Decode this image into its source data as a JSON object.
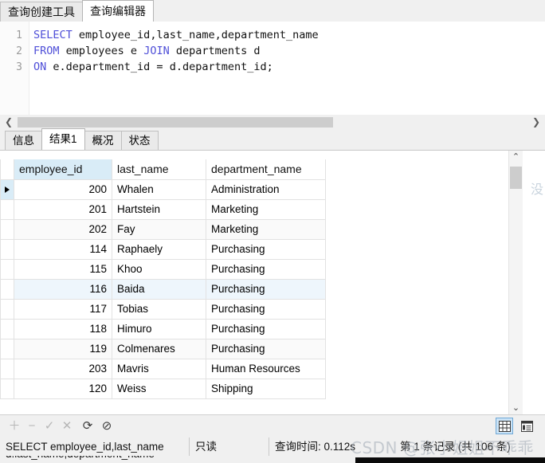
{
  "window": {
    "tabs": [
      {
        "label": "查询创建工具",
        "active": false
      },
      {
        "label": "查询编辑器",
        "active": true
      }
    ]
  },
  "editor": {
    "lines": [
      {
        "no": "1",
        "keyword": "SELECT",
        "rest": " employee_id,last_name,department_name"
      },
      {
        "no": "2",
        "keyword": "FROM",
        "rest": " employees e ",
        "keyword2": "JOIN",
        "rest2": " departments d"
      },
      {
        "no": "3",
        "keyword": "ON",
        "rest": " e.department_id = d.department_id;"
      }
    ]
  },
  "scroll": {
    "left_arrow": "❮",
    "right_arrow": "❯",
    "up_arrow": "⌃",
    "down_arrow": "⌄"
  },
  "result_tabs": [
    {
      "label": "信息",
      "active": false
    },
    {
      "label": "结果1",
      "active": true
    },
    {
      "label": "概况",
      "active": false
    },
    {
      "label": "状态",
      "active": false
    }
  ],
  "grid": {
    "columns": [
      "employee_id",
      "last_name",
      "department_name"
    ],
    "rows": [
      {
        "employee_id": "200",
        "last_name": "Whalen",
        "department_name": "Administration"
      },
      {
        "employee_id": "201",
        "last_name": "Hartstein",
        "department_name": "Marketing"
      },
      {
        "employee_id": "202",
        "last_name": "Fay",
        "department_name": "Marketing"
      },
      {
        "employee_id": "114",
        "last_name": "Raphaely",
        "department_name": "Purchasing"
      },
      {
        "employee_id": "115",
        "last_name": "Khoo",
        "department_name": "Purchasing"
      },
      {
        "employee_id": "116",
        "last_name": "Baida",
        "department_name": "Purchasing"
      },
      {
        "employee_id": "117",
        "last_name": "Tobias",
        "department_name": "Purchasing"
      },
      {
        "employee_id": "118",
        "last_name": "Himuro",
        "department_name": "Purchasing"
      },
      {
        "employee_id": "119",
        "last_name": "Colmenares",
        "department_name": "Purchasing"
      },
      {
        "employee_id": "203",
        "last_name": "Mavris",
        "department_name": "Human Resources"
      },
      {
        "employee_id": "120",
        "last_name": "Weiss",
        "department_name": "Shipping"
      }
    ],
    "current_row_index": 0,
    "selected_row_index": 5
  },
  "toolbar": {
    "add": "＋",
    "remove": "−",
    "confirm": "✓",
    "cancel": "✕",
    "refresh": "⟳",
    "stop": "⊘",
    "grid_view_icon": "grid-view",
    "form_view_icon": "form-view"
  },
  "status": {
    "sql_fragment": "SELECT employee_id,last_name",
    "readonly": "只读",
    "query_time": "查询时间: 0.112s",
    "record_info": "第 1 条记录 (共 106 条)",
    "second_line": "d.last_name,department_name"
  },
  "watermark": {
    "text": "CSDN @张小姐姐不乖乖",
    "side_char": "没"
  },
  "colors": {
    "accent": "#d9ecf7",
    "keyword": "#4f4fd8",
    "selection": "#eef6fc",
    "tab_active": "#ffffff"
  }
}
